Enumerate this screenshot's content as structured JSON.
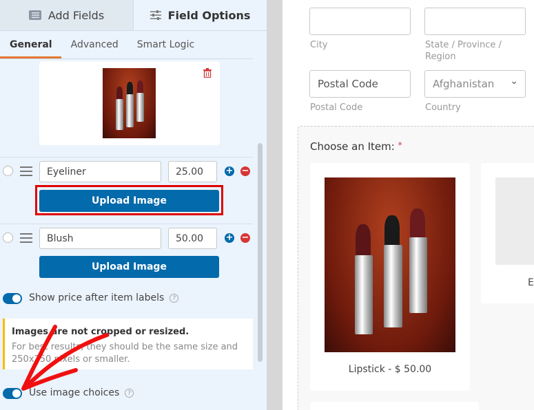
{
  "left_panel": {
    "tabs": [
      {
        "label": "Add Fields",
        "icon": "list-icon"
      },
      {
        "label": "Field Options",
        "icon": "sliders-icon"
      }
    ],
    "subtabs": [
      "General",
      "Advanced",
      "Smart Logic"
    ],
    "active_subtab": "General",
    "choices": [
      {
        "label": "Eyeliner",
        "price": "25.00",
        "upload_label": "Upload Image"
      },
      {
        "label": "Blush",
        "price": "50.00",
        "upload_label": "Upload Image"
      }
    ],
    "show_price": {
      "label": "Show price after item labels",
      "enabled": true
    },
    "notice": {
      "title": "Images are not cropped or resized.",
      "body": "For best results, they should be the same size and 250x250 pixels or smaller."
    },
    "use_image_choices": {
      "label": "Use image choices",
      "enabled": true
    },
    "help_glyph": "?"
  },
  "preview": {
    "address": {
      "city_label": "City",
      "state_label": "State / Province / Region",
      "postal_value": "Postal Code",
      "postal_label": "Postal Code",
      "country_value": "Afghanistan",
      "country_label": "Country"
    },
    "field_label": "Choose an Item:",
    "required_mark": "*",
    "items": [
      {
        "caption": "Lipstick - $ 50.00"
      },
      {
        "caption": "E"
      }
    ]
  },
  "colors": {
    "accent": "#036aab",
    "tab_underline": "#e27730",
    "highlight": "#e00000",
    "notice_border": "#ffb900"
  }
}
